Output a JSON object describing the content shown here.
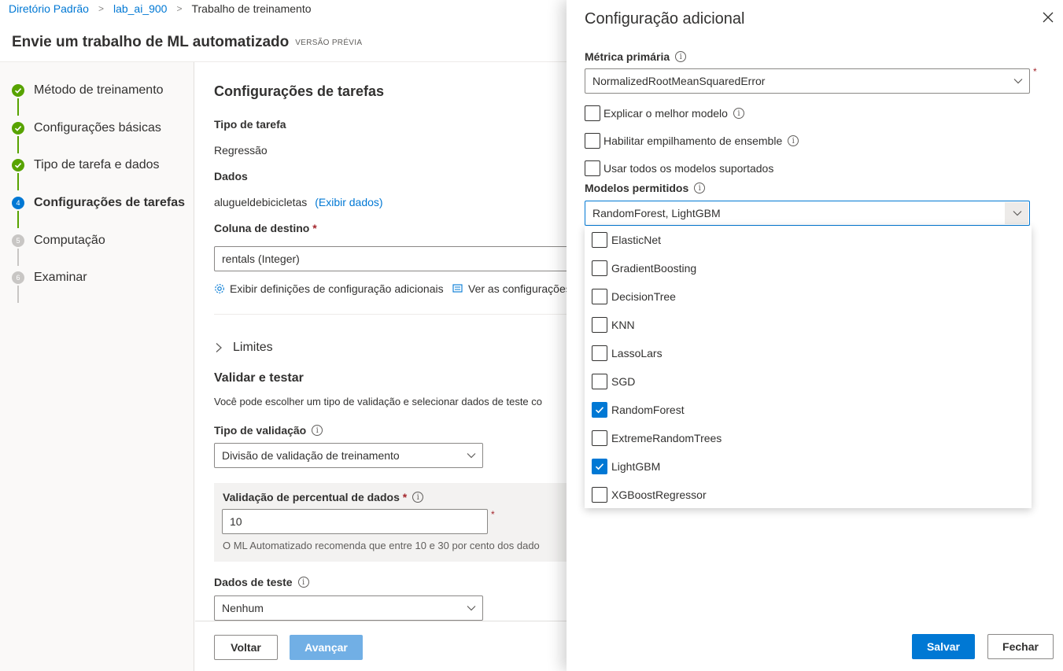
{
  "breadcrumb": {
    "items": [
      "Diretório Padrão",
      "lab_ai_900"
    ],
    "current": "Trabalho de treinamento"
  },
  "page": {
    "title": "Envie um trabalho de ML automatizado",
    "badge": "VERSÃO PRÉVIA"
  },
  "steps": [
    {
      "number": "1",
      "label": "Método de treinamento",
      "state": "done"
    },
    {
      "number": "2",
      "label": "Configurações básicas",
      "state": "done"
    },
    {
      "number": "3",
      "label": "Tipo de tarefa e dados",
      "state": "done"
    },
    {
      "number": "4",
      "label": "Configurações de tarefas",
      "state": "current"
    },
    {
      "number": "5",
      "label": "Computação",
      "state": "pending"
    },
    {
      "number": "6",
      "label": "Examinar",
      "state": "pending"
    }
  ],
  "main": {
    "section_title": "Configurações de tarefas",
    "task_type_label": "Tipo de tarefa",
    "task_type_value": "Regressão",
    "data_label": "Dados",
    "data_value": "alugueldebicicletas",
    "view_data_link": "(Exibir dados)",
    "target_label": "Coluna de destino",
    "required_mark": "*",
    "target_value": "rentals (Integer)",
    "additional_settings_link": "Exibir definições de configuração adicionais",
    "view_settings_link": "Ver as configurações",
    "limits_label": "Limites",
    "validate_title": "Validar e testar",
    "validate_desc": "Você pode escolher um tipo de validação e selecionar dados de teste co",
    "validation_type_label": "Tipo de validação",
    "validation_type_value": "Divisão de validação de treinamento",
    "percent_label": "Validação de percentual de dados",
    "percent_value": "10",
    "percent_hint": "O ML Automatizado recomenda que entre 10 e 30 por cento dos dado",
    "test_data_label": "Dados de teste",
    "test_data_value": "Nenhum",
    "back_button": "Voltar",
    "next_button": "Avançar"
  },
  "panel": {
    "title": "Configuração adicional",
    "primary_metric_label": "Métrica primária",
    "primary_metric_value": "NormalizedRootMeanSquaredError",
    "required_mark": "*",
    "explain_best_label": "Explicar o melhor modelo",
    "ensemble_label": "Habilitar empilhamento de ensemble",
    "use_all_label": "Usar todos os modelos suportados",
    "allowed_models_label": "Modelos permitidos",
    "allowed_models_value": "RandomForest, LightGBM",
    "options": [
      {
        "label": "ElasticNet",
        "checked": false
      },
      {
        "label": "GradientBoosting",
        "checked": false
      },
      {
        "label": "DecisionTree",
        "checked": false
      },
      {
        "label": "KNN",
        "checked": false
      },
      {
        "label": "LassoLars",
        "checked": false
      },
      {
        "label": "SGD",
        "checked": false
      },
      {
        "label": "RandomForest",
        "checked": true
      },
      {
        "label": "ExtremeRandomTrees",
        "checked": false
      },
      {
        "label": "LightGBM",
        "checked": true
      },
      {
        "label": "XGBoostRegressor",
        "checked": false
      }
    ],
    "save_button": "Salvar",
    "close_button": "Fechar"
  },
  "colors": {
    "accent": "#0078d4",
    "success": "#57a300",
    "required": "#a4262c"
  },
  "icons": [
    "check-icon",
    "info-icon",
    "chevron-down-icon",
    "chevron-right-icon",
    "close-icon",
    "gear-icon",
    "settings-list-icon"
  ]
}
